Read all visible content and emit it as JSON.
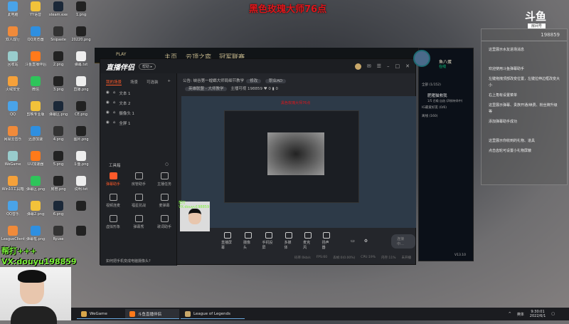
{
  "stream_title": "黑色玫瑰大师76点",
  "desktop_icons": [
    "此电脑",
    "YY语音",
    "steam.exe",
    "1.png",
    "双人成行",
    "QQ浏览器",
    "Snipaste",
    "20220.png",
    "回收站",
    "斗鱼直播伴侣",
    "2.png",
    "弹幕.txt",
    "火绒安全",
    "微信",
    "3.png",
    "直播.png",
    "QQ",
    "剪映专业版",
    "弹幕区.png",
    "CE.png",
    "网易云音乐",
    "迅游加速",
    "4.png",
    "图片.png",
    "WeGame",
    "UU加速器",
    "5.png",
    "斗鱼.png",
    "Win10工具箱",
    "弹幕区.png",
    "房管.png",
    "说明.txt",
    "QQ音乐",
    "弹幕2.png",
    "6.png",
    "",
    "LeagueClient",
    "弹幕框.png",
    "Ryuse",
    ""
  ],
  "lol_nav": [
    "PLAY",
    "主页",
    "云顶之弈",
    "冠军联赛"
  ],
  "app": {
    "logo": "直播伴侣",
    "pill": "帮助 ▸",
    "scene_tabs": [
      "我的场景",
      "场景",
      "可选装"
    ],
    "sources": [
      "文本 1",
      "文本 2",
      "摄像头 1",
      "全屏 1"
    ],
    "toolbox_label": "工具箱",
    "tools": [
      "弹幕助手",
      "房管助手",
      "主播任务",
      "视频连麦",
      "福星抗战",
      "麦弹幕",
      "虚拟形象",
      "弹幕秀",
      "歌词助手"
    ],
    "notice": "公告: 峡谷第一螳螂大师局细节教学",
    "edit": "修改",
    "category": "职业AD",
    "game": "英雄联盟 - 大师教学",
    "room": "主播可视 198859",
    "likes": "0",
    "viewers": "0",
    "buttons": [
      "直播屏幕",
      "摄像头",
      "手机投屏",
      "多媒体",
      "麦克风",
      "扬声器"
    ],
    "connect": "连接中...",
    "stats": [
      "码率:0kb/s",
      "FPS:60",
      "丢帧:0(0.00%)",
      "CPU:19%",
      "内存:11%",
      "未开播"
    ],
    "tip": "如何把手机变成电脑摄像头?",
    "preview_label": "黑色玫瑰大师76点",
    "cam_label": "帮打 VX:douyu198859"
  },
  "friends": {
    "name": "鱼八蛋",
    "status": "在线",
    "group1": "全部 (1/152)",
    "friend": "肥猪猫救我",
    "friend_status": "1/5 召唤 自选 (四排待命中)",
    "group2": "IG最爱好友 (0/6)",
    "group3": "离线 (160)",
    "version": "V13.10"
  },
  "danmu": {
    "logo": "斗鱼",
    "sub": "房间号",
    "room": "198859",
    "msgs": [
      "这里展示水友进场消息",
      "欢迎使用斗鱼弹幕助手",
      "左键拖拽顶部改变位置，左键拉伸边框改变大小",
      "右上角有设置菜单",
      "这里展示弹幕、贵族开通/续费、粉丝牌升级等",
      "添加弹幕助手成功",
      "这里展示你收到的礼物、道具",
      "点击齿轮可设置小礼物屏蔽"
    ]
  },
  "overlay": {
    "line1": "帮打+++",
    "line2": "VX:douyu198859"
  },
  "taskbar": {
    "items": [
      "WeGame",
      "斗鱼直播伴侣",
      "League of Legends"
    ],
    "ime": "英体",
    "time": "9:30:01",
    "date": "2022/6/1"
  }
}
